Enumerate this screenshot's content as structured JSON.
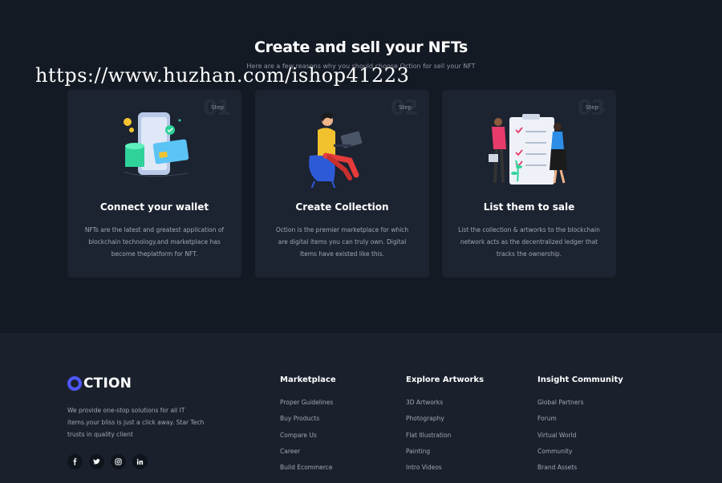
{
  "hero": {
    "title": "Create and sell your NFTs",
    "subtitle": "Here are a few reasons why you should choose Oction for sell your NFT",
    "watermark": "https://www.huzhan.com/ishop41223"
  },
  "steps": [
    {
      "number": "01",
      "step_label": "Step",
      "title": "Connect your wallet",
      "description": "NFTs are the latest and greatest application of blockchain technology.and marketplace has become theplatform for NFT.",
      "icon": "wallet-phone-illustration"
    },
    {
      "number": "02",
      "step_label": "Step",
      "title": "Create Collection",
      "description": "Oction is the premier marketplace for which are digital items you can truly own. Digital Items have existed like this.",
      "icon": "person-laptop-illustration"
    },
    {
      "number": "03",
      "step_label": "Step",
      "title": "List them to sale",
      "description": "List the collection & artworks to the blockchain network acts as the decentralized ledger that tracks the ownership.",
      "icon": "checklist-illustration"
    }
  ],
  "footer": {
    "logo_text": "CTION",
    "description": "We provide one-stop solutions for all IT items.your bliss is just a click away. Star Tech trusts in quality client",
    "socials": [
      "facebook-icon",
      "twitter-icon",
      "instagram-icon",
      "linkedin-icon"
    ],
    "columns": [
      {
        "heading": "Marketplace",
        "links": [
          "Proper Guidelines",
          "Buy Products",
          "Compare Us",
          "Career",
          "Build Ecommerce"
        ]
      },
      {
        "heading": "Explore Artworks",
        "links": [
          "3D Artworks",
          "Photography",
          "Flat Illustration",
          "Painting",
          "Intro Videos"
        ]
      },
      {
        "heading": "Insight Community",
        "links": [
          "Global Partners",
          "Forum",
          "Virtual World",
          "Community",
          "Brand Assets"
        ]
      }
    ]
  },
  "colors": {
    "background": "#141a24",
    "card": "#1c2331",
    "footer": "#1a212d",
    "accent": "#4f57ff"
  }
}
